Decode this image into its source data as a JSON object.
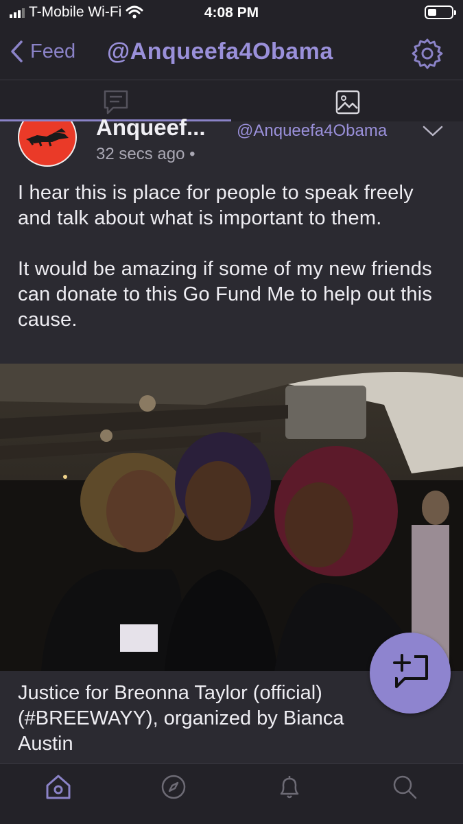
{
  "status_bar": {
    "carrier": "T-Mobile Wi-Fi",
    "time": "4:08 PM"
  },
  "nav": {
    "back_label": "Feed",
    "title": "@Anqueefa4Obama",
    "settings_icon": "gear-icon"
  },
  "tabs": [
    {
      "icon": "posts-icon",
      "selected": true
    },
    {
      "icon": "media-icon",
      "selected": false
    }
  ],
  "post": {
    "author_name": "Anqueef...",
    "author_handle": "@Anqueefa4Obama",
    "timestamp": "32 secs ago •",
    "paragraph_1": "I hear this is place for people to speak freely and talk about what is important to them.",
    "paragraph_2": "It would be amazing if some of my new friends can donate to this Go Fund Me to help out this cause.",
    "image_caption": "Justice for Breonna Taylor (official) (#BREEWAYY), organized by Bianca Austin"
  },
  "fab": {
    "icon": "compose-icon"
  },
  "bottom_nav": [
    {
      "icon": "home-icon",
      "active": true
    },
    {
      "icon": "explore-icon"
    },
    {
      "icon": "notifications-icon"
    },
    {
      "icon": "search-icon"
    }
  ],
  "colors": {
    "accent": "#8b83c8",
    "background": "#2b2a31",
    "bar": "#232228",
    "fab": "#8e84cf"
  }
}
